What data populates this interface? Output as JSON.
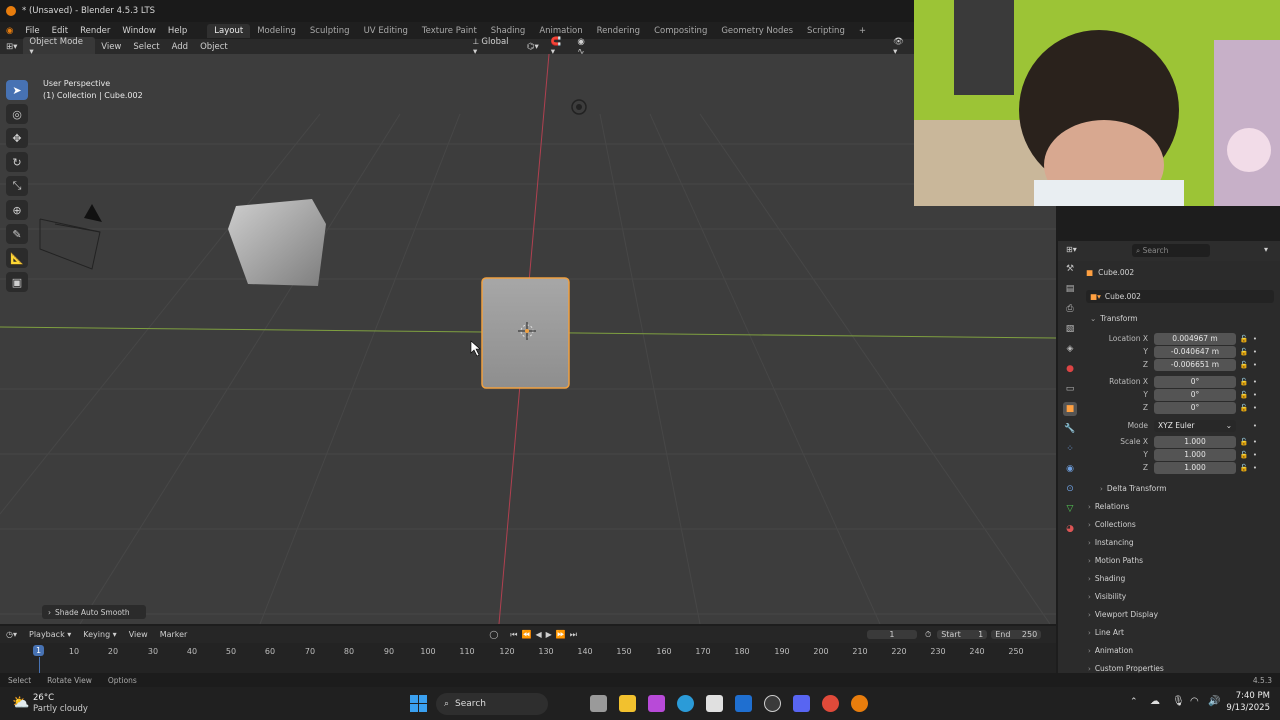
{
  "window": {
    "title": "* (Unsaved) - Blender 4.5.3 LTS"
  },
  "menu": [
    "File",
    "Edit",
    "Render",
    "Window",
    "Help"
  ],
  "workspaces": [
    "Layout",
    "Modeling",
    "Sculpting",
    "UV Editing",
    "Texture Paint",
    "Shading",
    "Animation",
    "Rendering",
    "Compositing",
    "Geometry Nodes",
    "Scripting"
  ],
  "viewport_header": {
    "mode": "Object Mode",
    "view": "View",
    "select": "Select",
    "add": "Add",
    "object": "Object",
    "orientation": "Global"
  },
  "viewport": {
    "perspective": "User Perspective",
    "collection": "(1) Collection | Cube.002",
    "last_op": "Shade Auto Smooth"
  },
  "timeline": {
    "playback": "Playback",
    "keying": "Keying",
    "view": "View",
    "marker": "Marker",
    "current_frame": "1",
    "start_label": "Start",
    "start": "1",
    "end_label": "End",
    "end": "250",
    "ticks": [
      "10",
      "20",
      "30",
      "40",
      "50",
      "60",
      "70",
      "80",
      "90",
      "100",
      "110",
      "120",
      "130",
      "140",
      "150",
      "160",
      "170",
      "180",
      "190",
      "200",
      "210",
      "220",
      "230",
      "240",
      "250"
    ],
    "cursor_label": "1"
  },
  "status": {
    "select": "Select",
    "rotate": "Rotate View",
    "options": "Options",
    "version": "4.5.3"
  },
  "properties": {
    "search_placeholder": "Search",
    "object_name": "Cube.002",
    "data_name": "Cube.002",
    "transform_label": "Transform",
    "location": {
      "label": "Location X",
      "x": "0.004967 m",
      "y": "-0.040647 m",
      "z": "-0.006651 m"
    },
    "rotation": {
      "label": "Rotation X",
      "x": "0°",
      "y": "0°",
      "z": "0°"
    },
    "mode_label": "Mode",
    "mode": "XYZ Euler",
    "scale": {
      "label": "Scale X",
      "x": "1.000",
      "y": "1.000",
      "z": "1.000"
    },
    "axis_y": "Y",
    "axis_z": "Z",
    "delta": "Delta Transform",
    "panels": [
      "Relations",
      "Collections",
      "Instancing",
      "Motion Paths",
      "Shading",
      "Visibility",
      "Viewport Display",
      "Line Art",
      "Animation",
      "Custom Properties"
    ]
  },
  "taskbar": {
    "weather_temp": "26°C",
    "weather_desc": "Partly cloudy",
    "search": "Search",
    "time": "7:40 PM",
    "date": "9/13/2025"
  },
  "colors": {
    "accent": "#4772b3",
    "selected_outline": "#f0a040",
    "x_axis": "#b04050",
    "y_axis": "#7fa040"
  }
}
